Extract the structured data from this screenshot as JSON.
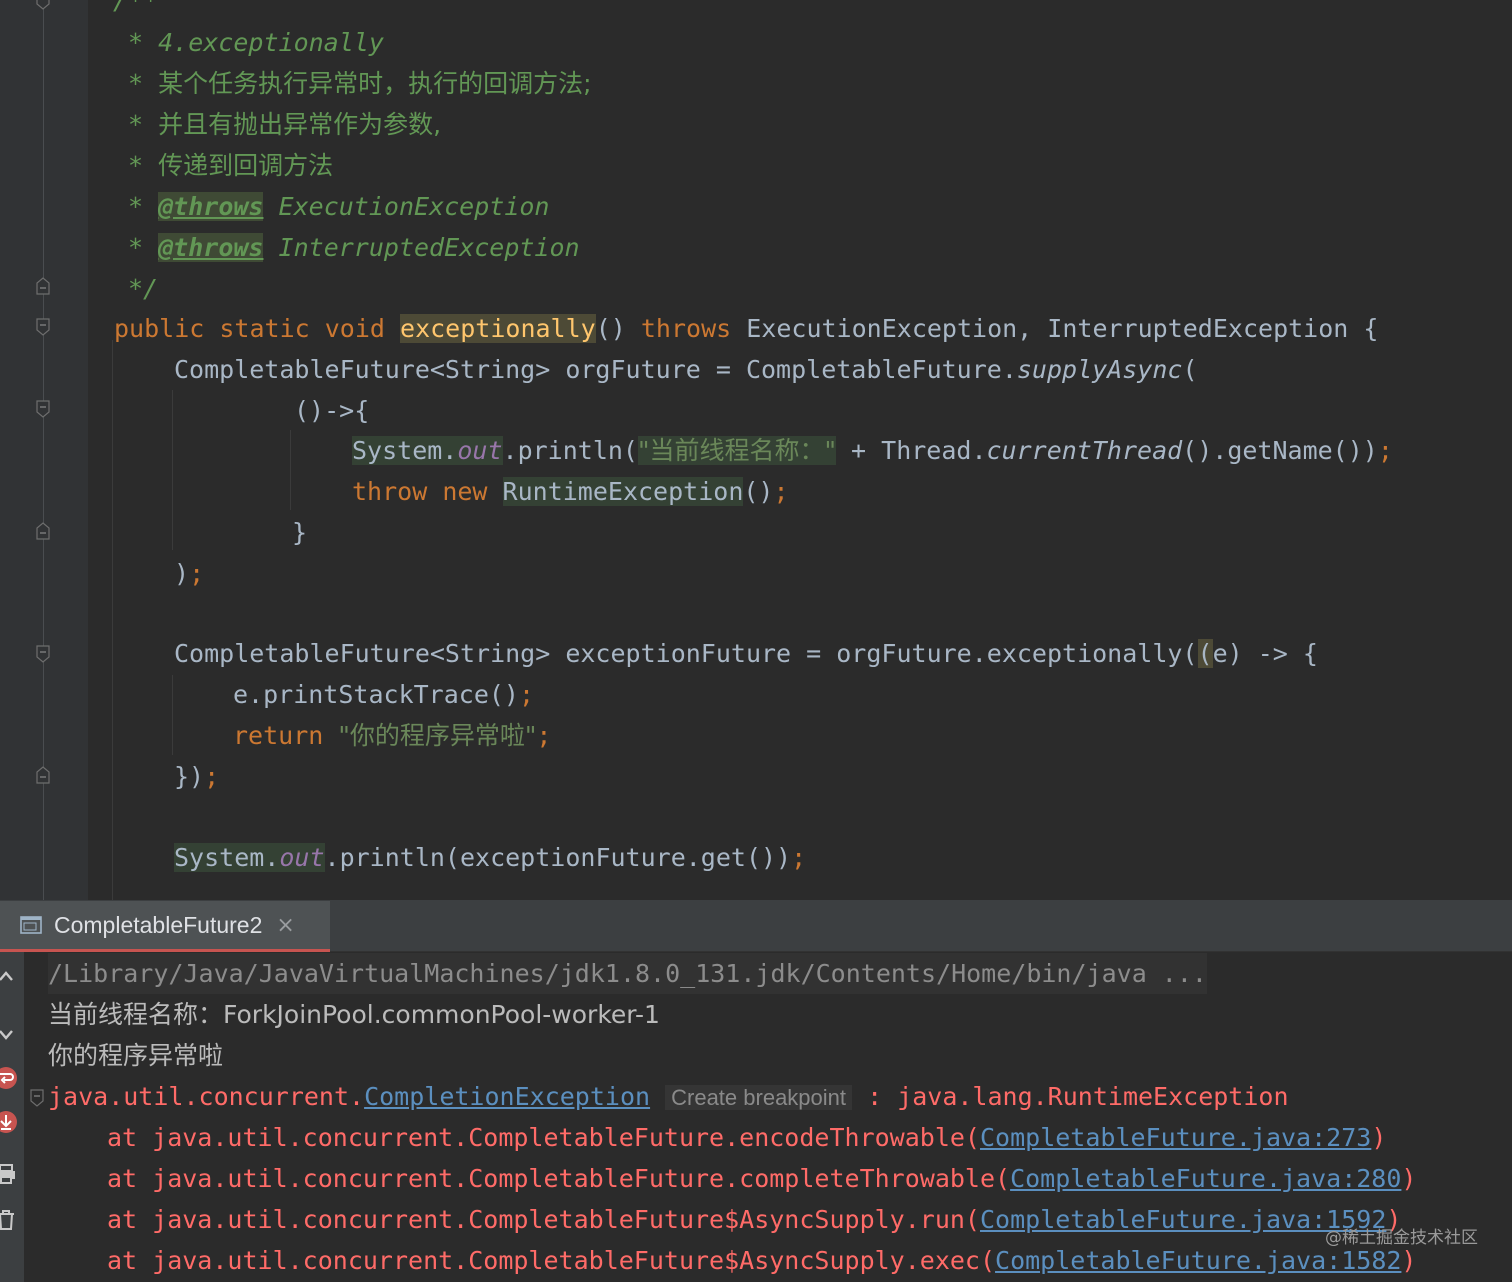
{
  "editor": {
    "comment": {
      "open": "/**",
      "line1": "* 4.exceptionally",
      "star": "*",
      "line2": "某个任务执行异常时，执行的回调方法;",
      "line3": "并且有抛出异常作为参数,",
      "line4": "传递到回调方法",
      "throws_tag": "@throws",
      "throws1": "ExecutionException",
      "throws2": "InterruptedException",
      "close": "*/"
    },
    "sig": {
      "public": "public",
      "static": "static",
      "void": "void",
      "method": "exceptionally",
      "parens": "()",
      "throws": "throws",
      "ex1": "ExecutionException,",
      "ex2": "InterruptedException {"
    },
    "line_org": {
      "decl": "CompletableFuture<String> orgFuture = CompletableFuture.",
      "call": "supplyAsync",
      "paren": "("
    },
    "lambda_open": "()->{",
    "println1": {
      "system": "System.",
      "out": "out",
      "println": ".println(",
      "str": "\"当前线程名称：\"",
      "concat": " + Thread.",
      "current": "currentThread",
      "rest": "().getName())",
      "semi": ";"
    },
    "throw_line": {
      "throw": "throw",
      "new": "new",
      "cls": "RuntimeException",
      "rest": "()",
      "semi": ";"
    },
    "close_brace": "}",
    "close_paren": ")",
    "semi": ";",
    "line_exc": {
      "decl": "CompletableFuture<String> exceptionFuture = orgFuture.exceptionally(",
      "paren": "(",
      "rest": "e) -> {"
    },
    "print_trace": {
      "call": "e.printStackTrace()",
      "semi": ";"
    },
    "return_line": {
      "kw": "return",
      "str": "\"你的程序异常啦\"",
      "semi": ";"
    },
    "close_lambda": "})",
    "println2": {
      "system": "System.",
      "out": "out",
      "rest": ".println(exceptionFuture.get())",
      "semi": ";"
    }
  },
  "run_panel": {
    "tab_label": "CompletableFuture2",
    "tab_close": "×",
    "console": {
      "cmd": "/Library/Java/JavaVirtualMachines/jdk1.8.0_131.jdk/Contents/Home/bin/java ...",
      "out1": "当前线程名称：ForkJoinPool.commonPool-worker-1",
      "out2": "你的程序异常啦",
      "exc_prefix": "java.util.concurrent.",
      "exc_class": "CompletionException",
      "exc_hint": "Create breakpoint",
      "exc_suffix": " : java.lang.RuntimeException",
      "frames": [
        {
          "at": "at java.util.concurrent.CompletableFuture.encodeThrowable(",
          "link": "CompletableFuture.java:273",
          "end": ")"
        },
        {
          "at": "at java.util.concurrent.CompletableFuture.completeThrowable(",
          "link": "CompletableFuture.java:280",
          "end": ")"
        },
        {
          "at": "at java.util.concurrent.CompletableFuture$AsyncSupply.run(",
          "link": "CompletableFuture.java:1592",
          "end": ")"
        },
        {
          "at": "at java.util.concurrent.CompletableFuture$AsyncSupply.exec(",
          "link": "CompletableFuture.java:1582",
          "end": ")"
        }
      ]
    }
  },
  "watermark": "@稀土掘金技术社区",
  "colors": {
    "background": "#2b2b2b",
    "keyword": "#cc7832",
    "comment": "#629755",
    "string": "#6a8759",
    "field": "#9876aa",
    "error": "#ff6b68",
    "link": "#5b8fbf"
  }
}
